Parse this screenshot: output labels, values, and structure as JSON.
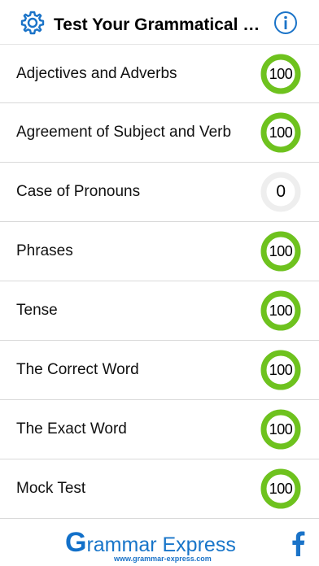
{
  "header": {
    "title": "Test Your Grammatical Skills",
    "settings_icon": "gear-icon",
    "info_icon": "info-icon"
  },
  "topics": [
    {
      "label": "Adjectives and Adverbs",
      "score": "100",
      "progress": 1.0
    },
    {
      "label": "Agreement of Subject and Verb",
      "score": "100",
      "progress": 1.0
    },
    {
      "label": "Case of Pronouns",
      "score": "0",
      "progress": 0.0
    },
    {
      "label": "Phrases",
      "score": "100",
      "progress": 1.0
    },
    {
      "label": "Tense",
      "score": "100",
      "progress": 1.0
    },
    {
      "label": "The Correct Word",
      "score": "100",
      "progress": 1.0
    },
    {
      "label": "The Exact Word",
      "score": "100",
      "progress": 1.0
    },
    {
      "label": "Mock Test",
      "score": "100",
      "progress": 1.0
    }
  ],
  "footer": {
    "logo_initial": "G",
    "logo_rest": "rammar Express",
    "logo_url": "www.grammar-express.com",
    "facebook_icon": "facebook-icon"
  },
  "colors": {
    "accent": "#1a73c8",
    "ring_complete": "#6ec21e",
    "ring_empty": "#eeeeee",
    "divider": "#d9d9d9"
  }
}
